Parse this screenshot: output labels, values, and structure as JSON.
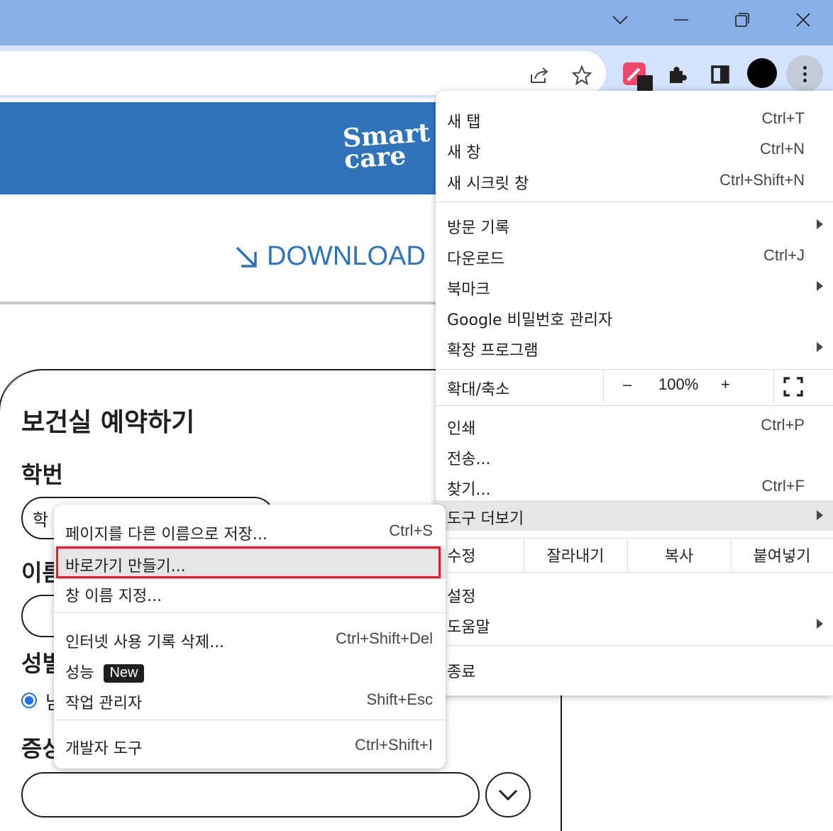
{
  "window": {
    "controls": [
      "chevron-down-icon",
      "minimize-icon",
      "restore-icon",
      "close-icon"
    ]
  },
  "toolbar": {
    "icons": [
      "share-icon",
      "bookmark-star-icon",
      "eyedropper-extension-icon",
      "puzzle-extensions-icon",
      "side-panel-icon",
      "profile-avatar",
      "more-vert-icon"
    ]
  },
  "page": {
    "logo_line1": "Smart",
    "logo_line2": "care",
    "download_label": "DOWNLOAD",
    "form_title": "보건실 예약하기",
    "student_id_label": "학번",
    "student_id_value": "학",
    "name_label": "이름",
    "gender_label": "성별",
    "gender_option": "남",
    "symptom_label": "증상",
    "brand_color": "#2f74ba"
  },
  "menu": {
    "new_tab": "새 탭",
    "new_tab_sc": "Ctrl+T",
    "new_window": "새 창",
    "new_window_sc": "Ctrl+N",
    "incognito": "새 시크릿 창",
    "incognito_sc": "Ctrl+Shift+N",
    "history": "방문 기록",
    "downloads": "다운로드",
    "downloads_sc": "Ctrl+J",
    "bookmarks": "북마크",
    "passwords": "Google 비밀번호 관리자",
    "extensions": "확장 프로그램",
    "zoom_label": "확대/축소",
    "zoom_minus": "–",
    "zoom_value": "100%",
    "zoom_plus": "+",
    "print": "인쇄",
    "print_sc": "Ctrl+P",
    "cast": "전송...",
    "find": "찾기...",
    "find_sc": "Ctrl+F",
    "more_tools": "도구 더보기",
    "edit": "수정",
    "cut": "잘라내기",
    "copy": "복사",
    "paste": "붙여넣기",
    "settings": "설정",
    "help": "도움말",
    "exit": "종료"
  },
  "submenu": {
    "save_as": "페이지를 다른 이름으로 저장...",
    "save_as_sc": "Ctrl+S",
    "create_shortcut": "바로가기 만들기...",
    "name_window": "창 이름 지정...",
    "clear_data": "인터넷 사용 기록 삭제...",
    "clear_data_sc": "Ctrl+Shift+Del",
    "performance": "성능",
    "performance_badge": "New",
    "task_manager": "작업 관리자",
    "task_manager_sc": "Shift+Esc",
    "dev_tools": "개발자 도구",
    "dev_tools_sc": "Ctrl+Shift+I"
  }
}
